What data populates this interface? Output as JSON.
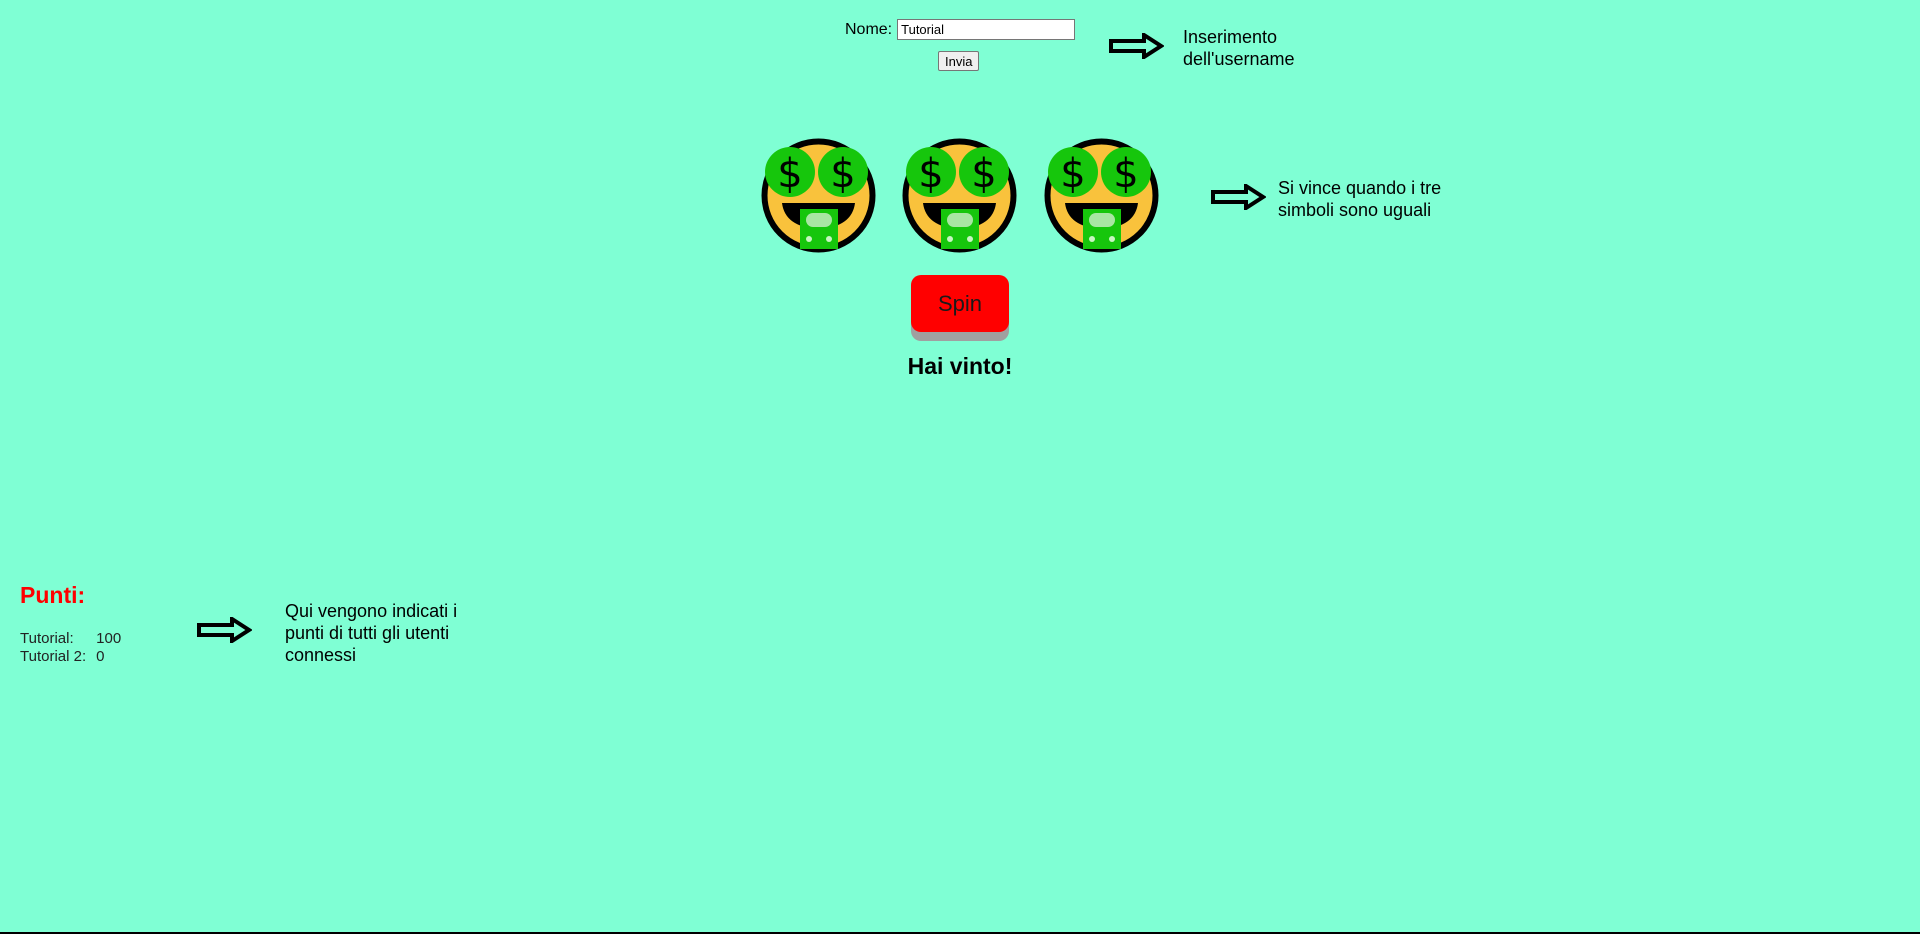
{
  "form": {
    "name_label": "Nome:",
    "name_value": "Tutorial",
    "send_label": "Invia"
  },
  "annotations": {
    "username": "Inserimento dell'username",
    "win": "Si vince quando i tre simboli sono uguali",
    "points": "Qui vengono indicati i punti di tutti gli utenti connessi"
  },
  "slots": [
    {
      "symbol": "money-mouth-face-icon"
    },
    {
      "symbol": "money-mouth-face-icon"
    },
    {
      "symbol": "money-mouth-face-icon"
    }
  ],
  "spin_label": "Spin",
  "result": "Hai vinto!",
  "points": {
    "title": "Punti:",
    "users": [
      {
        "name": "Tutorial:",
        "score": "100"
      },
      {
        "name": "Tutorial 2:",
        "score": "0"
      }
    ]
  },
  "colors": {
    "background": "#7fffd4",
    "spin_button": "#ff0000",
    "points_title": "#ff0000"
  }
}
